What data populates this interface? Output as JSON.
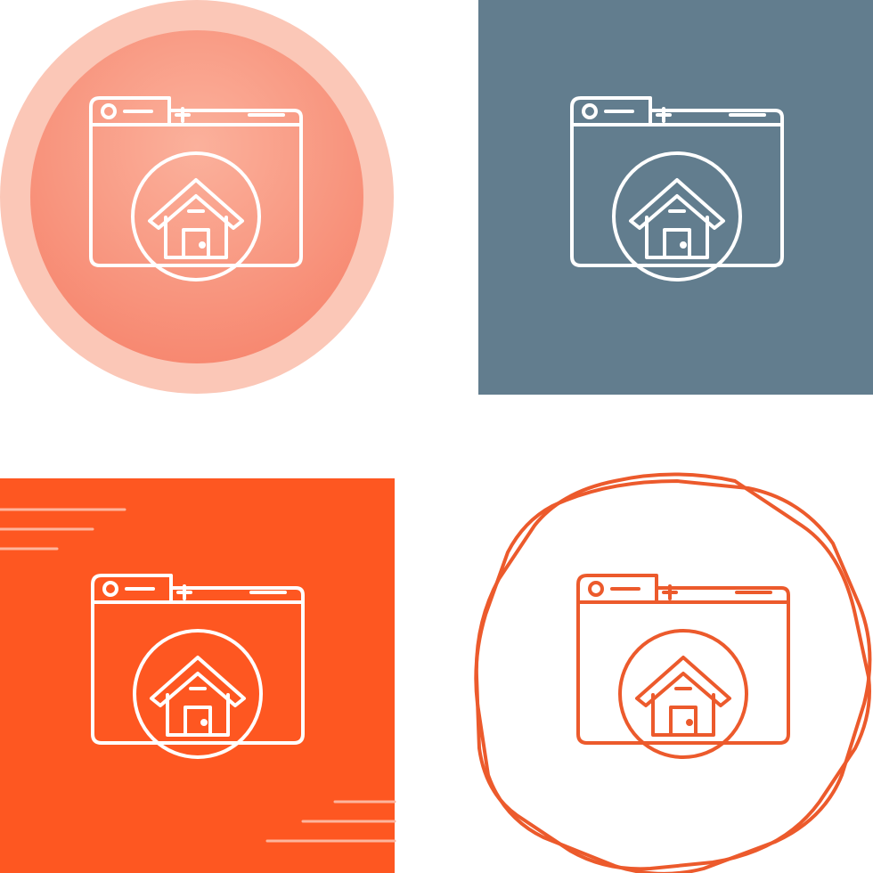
{
  "icon_name": "browser-home-icon",
  "colors": {
    "background": "#ffffff",
    "tile1_outer": "#fbc7b7",
    "tile1_inner_light": "#fbb19c",
    "tile1_inner_dark": "#f6826a",
    "tile1_stroke": "#ffffff",
    "tile2_bg": "#627d8e",
    "tile2_stroke": "#ffffff",
    "tile3_bg": "#fe5721",
    "tile3_stroke": "#ffffff",
    "tile3_lines": "#fdb59d",
    "tile4_stroke": "#ec5a2c"
  },
  "variants": [
    {
      "id": "gradient-circle",
      "style": "two-tone gradient circle"
    },
    {
      "id": "slate-square",
      "style": "slate blue square"
    },
    {
      "id": "orange-square",
      "style": "orange square with speed lines"
    },
    {
      "id": "outline-octagon",
      "style": "outline with double octagon frame"
    }
  ]
}
